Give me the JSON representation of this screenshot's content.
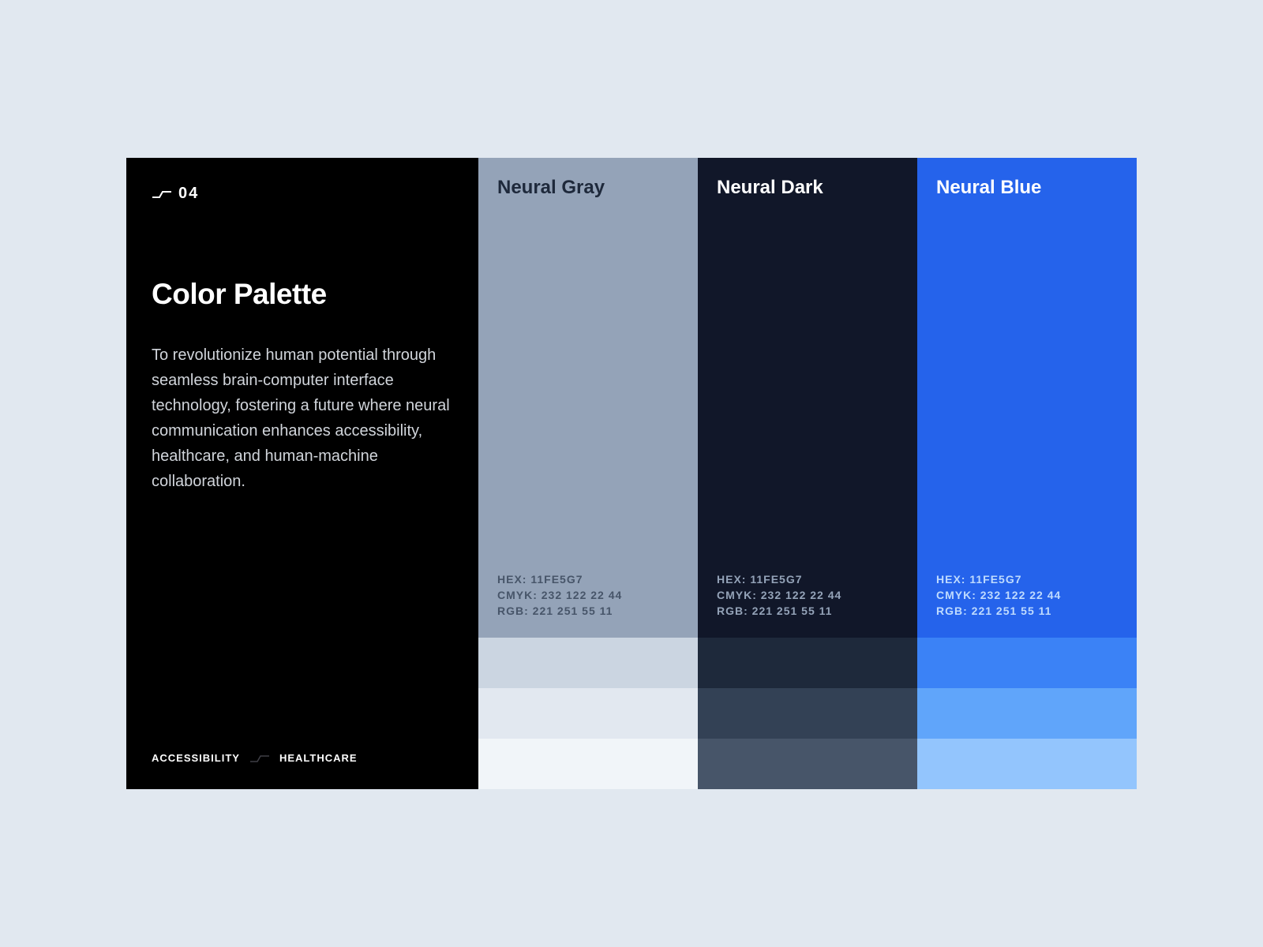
{
  "info": {
    "section_number": "04",
    "title": "Color Palette",
    "description": "To revolutionize human potential through seamless brain-computer interface technology, fostering a future where neural communication enhances accessibility, healthcare, and human-machine collaboration.",
    "tags": [
      "ACCESSIBILITY",
      "HEALTHCARE"
    ]
  },
  "swatches": [
    {
      "name": "Neural Gray",
      "hex": "HEX: 11FE5G7",
      "cmyk": "CMYK: 232 122 22 44",
      "rgb": "RGB: 221 251 55 11",
      "color": "#94a3b8",
      "text_color": "#1e293b",
      "code_color": "#475569",
      "tints": [
        "#cbd5e1",
        "#e2e8f0",
        "#f1f5f9"
      ]
    },
    {
      "name": "Neural Dark",
      "hex": "HEX: 11FE5G7",
      "cmyk": "CMYK: 232 122 22 44",
      "rgb": "RGB: 221 251 55 11",
      "color": "#111729",
      "text_color": "#ffffff",
      "code_color": "#94a3b8",
      "tints": [
        "#1e293b",
        "#334155",
        "#475569"
      ]
    },
    {
      "name": "Neural Blue",
      "hex": "HEX: 11FE5G7",
      "cmyk": "CMYK: 232 122 22 44",
      "rgb": "RGB: 221 251 55 11",
      "color": "#2563eb",
      "text_color": "#ffffff",
      "code_color": "#bfdbfe",
      "tints": [
        "#3b82f6",
        "#60a5fa",
        "#93c5fd"
      ]
    }
  ],
  "icons": {
    "section": "step-line-icon",
    "tag_separator": "step-line-icon"
  }
}
